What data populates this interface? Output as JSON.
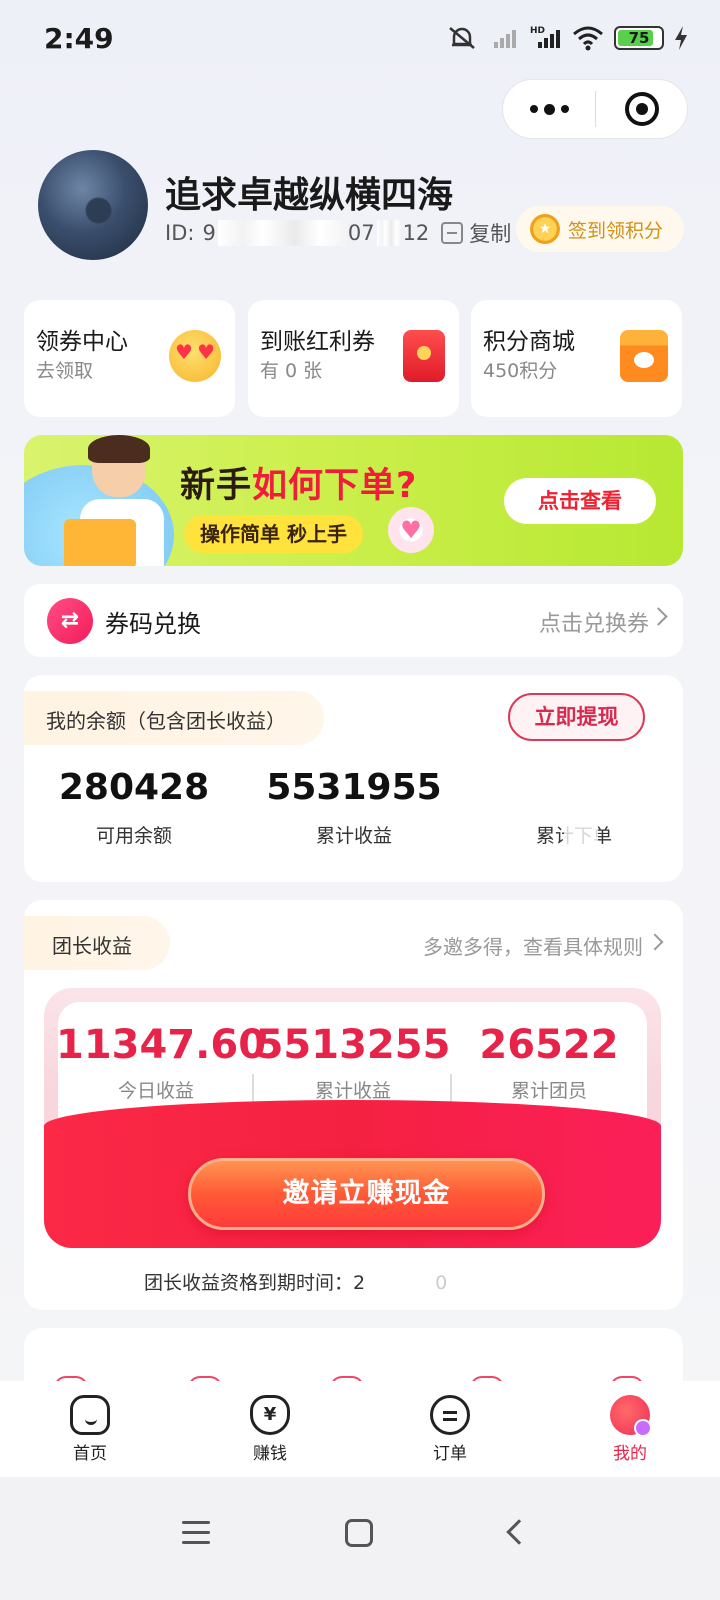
{
  "status_bar": {
    "time": "2:49",
    "battery": "75",
    "network": "HD"
  },
  "profile": {
    "name": "追求卓越纵横四海",
    "id_prefix": "ID:",
    "id_visible_1": "9",
    "id_visible_2": "07",
    "id_visible_3": "12",
    "copy_label": "复制",
    "signin_label": "签到领积分"
  },
  "quick_cards": [
    {
      "title": "领券中心",
      "subtitle": "去领取",
      "icon": "heart-eyes-emoji-icon"
    },
    {
      "title": "到账红利券",
      "subtitle": "有 0 张",
      "icon": "red-packet-icon"
    },
    {
      "title": "积分商城",
      "subtitle": "450积分",
      "icon": "shop-icon"
    }
  ],
  "banner": {
    "title_prefix": "新手",
    "title_highlight": "如何下单?",
    "pill": "操作简单 秒上手",
    "button": "点击查看"
  },
  "coupon_code": {
    "title": "券码兑换",
    "action": "点击兑换券"
  },
  "balance": {
    "tag": "我的余额（包含团长收益）",
    "withdraw": "立即提现",
    "stats": [
      {
        "value": "280428",
        "label": "可用余额"
      },
      {
        "value": "5531955",
        "label": "累计收益"
      },
      {
        "value": "",
        "label": "累计下单"
      }
    ]
  },
  "leader": {
    "tag": "团长收益",
    "rules": "多邀多得，查看具体规则",
    "stats": [
      {
        "value": "11347.60",
        "label": "今日收益"
      },
      {
        "value": "5513255",
        "label": "累计收益"
      },
      {
        "value": "26522",
        "label": "累计团员"
      }
    ],
    "invite_button": "邀请立赚现金",
    "expiry_label": "团长收益资格到期时间：2",
    "expiry_tail": "0"
  },
  "tabbar": [
    {
      "label": "首页",
      "active": false
    },
    {
      "label": "赚钱",
      "active": false
    },
    {
      "label": "订单",
      "active": false
    },
    {
      "label": "我的",
      "active": true
    }
  ],
  "colors": {
    "accent": "#e8234a",
    "banner_bg": "#ccef4c",
    "gold": "#d49012"
  }
}
